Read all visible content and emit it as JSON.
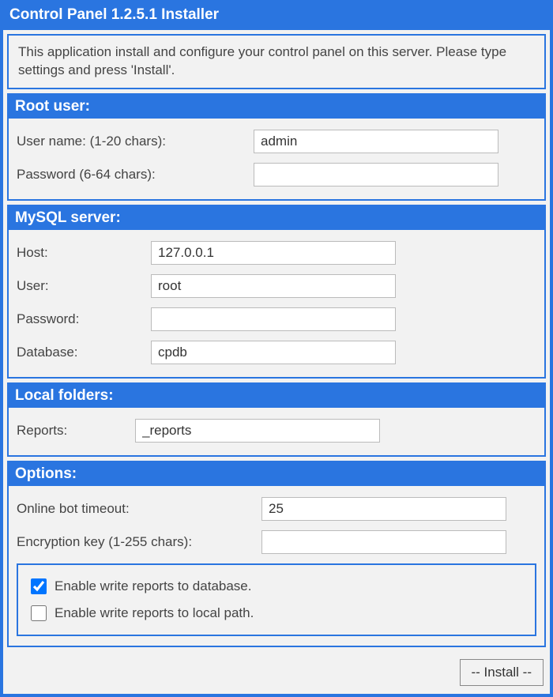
{
  "title": "Control Panel 1.2.5.1 Installer",
  "intro": "This application install and configure your control panel on this server. Please type settings and press 'Install'.",
  "root": {
    "header": "Root user:",
    "username_label": "User name: (1-20 chars):",
    "username_value": "admin",
    "password_label": "Password (6-64 chars):",
    "password_value": ""
  },
  "mysql": {
    "header": "MySQL server:",
    "host_label": "Host:",
    "host_value": "127.0.0.1",
    "user_label": "User:",
    "user_value": "root",
    "password_label": "Password:",
    "password_value": "",
    "database_label": "Database:",
    "database_value": "cpdb"
  },
  "local": {
    "header": "Local folders:",
    "reports_label": "Reports:",
    "reports_value": "_reports"
  },
  "options": {
    "header": "Options:",
    "timeout_label": "Online bot timeout:",
    "timeout_value": "25",
    "enckey_label": "Encryption key (1-255 chars):",
    "enckey_value": "",
    "enable_db_label": "Enable write reports to database.",
    "enable_db_checked": true,
    "enable_local_label": "Enable write reports to local path.",
    "enable_local_checked": false
  },
  "footer": {
    "install_label": "-- Install --"
  }
}
